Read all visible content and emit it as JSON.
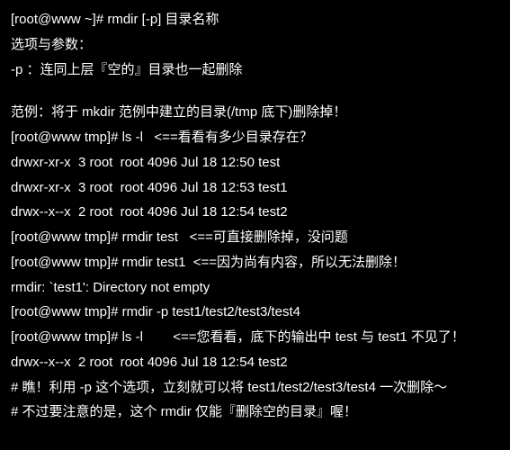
{
  "lines": {
    "l0": "[root@www ~]# rmdir [-p] 目录名称",
    "l1": "选项与参数：",
    "l2": "-p ：连同上层『空的』目录也一起删除",
    "l3": "范例：将于 mkdir 范例中建立的目录(/tmp 底下)删除掉！",
    "l4": "[root@www tmp]# ls -l   <==看看有多少目录存在？",
    "l5": "drwxr-xr-x  3 root  root 4096 Jul 18 12:50 test",
    "l6": "drwxr-xr-x  3 root  root 4096 Jul 18 12:53 test1",
    "l7": "drwx--x--x  2 root  root 4096 Jul 18 12:54 test2",
    "l8": "[root@www tmp]# rmdir test   <==可直接删除掉，没问题",
    "l9": "[root@www tmp]# rmdir test1  <==因为尚有内容，所以无法删除！",
    "l10": "rmdir: `test1': Directory not empty",
    "l11": "[root@www tmp]# rmdir -p test1/test2/test3/test4",
    "l12": "[root@www tmp]# ls -l        <==您看看，底下的输出中 test 与 test1 不见了！",
    "l13": "drwx--x--x  2 root  root 4096 Jul 18 12:54 test2",
    "l14": "# 瞧！利用 -p 这个选项，立刻就可以将 test1/test2/test3/test4 一次删除～",
    "l15": "# 不过要注意的是，这个 rmdir 仅能『删除空的目录』喔！"
  }
}
